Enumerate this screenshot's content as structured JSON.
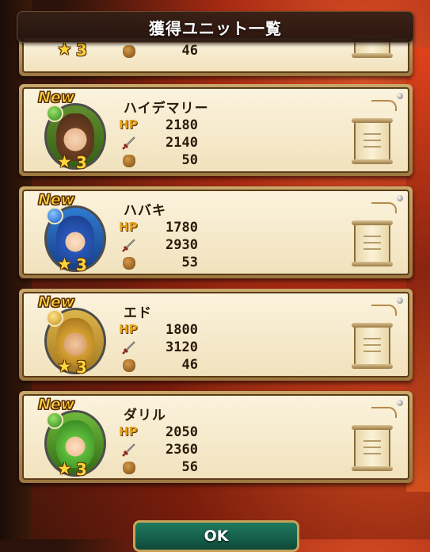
{
  "header": {
    "title": "獲得ユニット一覧"
  },
  "partial_unit": {
    "rarity": "3",
    "cost": "46"
  },
  "units": [
    {
      "new_label": "New",
      "name": "ハイデマリー",
      "hp_label": "HP",
      "hp": "2180",
      "atk": "2140",
      "cost": "50",
      "rarity": "3",
      "element_color": "#3f9a24"
    },
    {
      "new_label": "New",
      "name": "ハバキ",
      "hp_label": "HP",
      "hp": "1780",
      "atk": "2930",
      "cost": "53",
      "rarity": "3",
      "element_color": "#1f5fcf"
    },
    {
      "new_label": "New",
      "name": "エド",
      "hp_label": "HP",
      "hp": "1800",
      "atk": "3120",
      "cost": "46",
      "rarity": "3",
      "element_color": "#c8951d"
    },
    {
      "new_label": "New",
      "name": "ダリル",
      "hp_label": "HP",
      "hp": "2050",
      "atk": "2360",
      "cost": "56",
      "rarity": "3",
      "element_color": "#3f9a24"
    }
  ],
  "footer": {
    "ok_label": "OK"
  }
}
